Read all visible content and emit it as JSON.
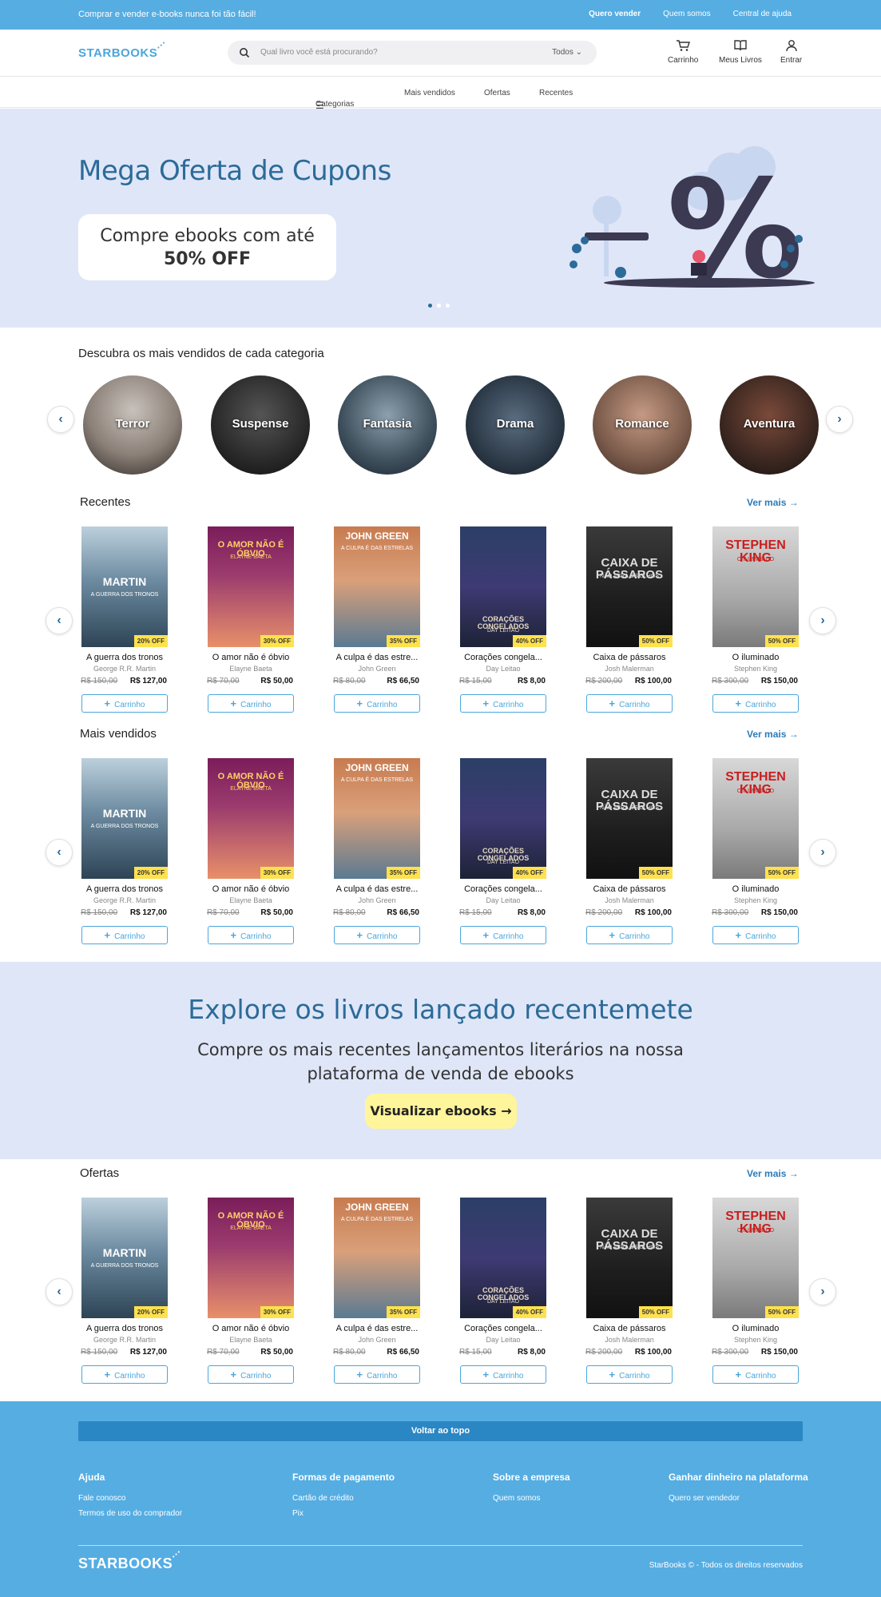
{
  "topbar": {
    "promo": "Comprar e vender e-books nunca foi tão fácil!",
    "links": [
      "Quero vender",
      "Quem somos",
      "Central de ajuda"
    ]
  },
  "header": {
    "logo": "STARBOOKS",
    "search_placeholder": "Qual livro você está procurando?",
    "search_filter": "Todos",
    "cart_label": "Carrinho",
    "mybooks_label": "Meus Livros",
    "login_label": "Entrar"
  },
  "nav": {
    "categories": "Categorias",
    "bestsellers": "Mais vendidos",
    "offers": "Ofertas",
    "recent": "Recentes"
  },
  "hero": {
    "title": "Mega Oferta de Cupons",
    "box_line1": "Compre ebooks com até",
    "box_line2": "50% OFF",
    "slide_count": 3,
    "active_slide": 1
  },
  "categories": {
    "title": "Descubra os mais vendidos de cada categoria",
    "items": [
      "Terror",
      "Suspense",
      "Fantasia",
      "Drama",
      "Romance",
      "Aventura"
    ]
  },
  "sections": {
    "recent": "Recentes",
    "bestsellers": "Mais vendidos",
    "offers": "Ofertas",
    "see_more": "Ver mais"
  },
  "cart_button": "Carrinho",
  "products": [
    {
      "title": "A guerra dos tronos",
      "author": "George R.R. Martin",
      "old_price": "R$ 150,00",
      "price": "R$ 127,00",
      "discount": "20% OFF",
      "cover_text": "MARTIN",
      "cover_sub": "A GUERRA DOS TRONOS"
    },
    {
      "title": "O amor não é óbvio",
      "author": "Elayne Baeta",
      "old_price": "R$ 70,00",
      "price": "R$ 50,00",
      "discount": "30% OFF",
      "cover_text": "O AMOR NÃO É ÓBVIO",
      "cover_sub": "ELAYNE BAETA"
    },
    {
      "title": "A culpa é das estre...",
      "author": "John Green",
      "old_price": "R$ 80,00",
      "price": "R$ 66,50",
      "discount": "35% OFF",
      "cover_text": "JOHN GREEN",
      "cover_sub": "A CULPA É DAS ESTRELAS"
    },
    {
      "title": "Corações congela...",
      "author": "Day Leitao",
      "old_price": "R$ 15,00",
      "price": "R$ 8,00",
      "discount": "40% OFF",
      "cover_text": "CORAÇÕES CONGELADOS",
      "cover_sub": "DAY LEITAO"
    },
    {
      "title": "Caixa de pássaros",
      "author": "Josh Malerman",
      "old_price": "R$ 200,00",
      "price": "R$ 100,00",
      "discount": "50% OFF",
      "cover_text": "CAIXA DE PÁSSAROS",
      "cover_sub": "NÃO ABRA OS OLHOS"
    },
    {
      "title": "O iluminado",
      "author": "Stephen King",
      "old_price": "R$ 300,00",
      "price": "R$ 150,00",
      "discount": "50% OFF",
      "cover_text": "STEPHEN KING",
      "cover_sub": "O ILUMINADO"
    }
  ],
  "explore": {
    "title": "Explore os livros lançado recentemete",
    "text": "Compre os mais recentes lançamentos literários na nossa plataforma de venda de ebooks",
    "cta": "Visualizar ebooks"
  },
  "footer": {
    "back_to_top": "Voltar ao topo",
    "columns": [
      {
        "title": "Ajuda",
        "links": [
          "Fale conosco",
          "Termos de uso do comprador"
        ]
      },
      {
        "title": "Formas de pagamento",
        "links": [
          "Cartão de crédito",
          "Pix"
        ]
      },
      {
        "title": "Sobre a empresa",
        "links": [
          "Quem somos"
        ]
      },
      {
        "title": "Ganhar dinheiro na plataforma",
        "links": [
          "Quero ser vendedor"
        ]
      }
    ],
    "logo": "STARBOOKS",
    "copyright": "StarBooks © - Todos os direitos reservados"
  },
  "colors": {
    "primary": "#55ade2",
    "accent_dark": "#2b6b98",
    "hero_bg": "#dfe6f8",
    "badge": "#ffe14d",
    "cta": "#fff59a"
  }
}
